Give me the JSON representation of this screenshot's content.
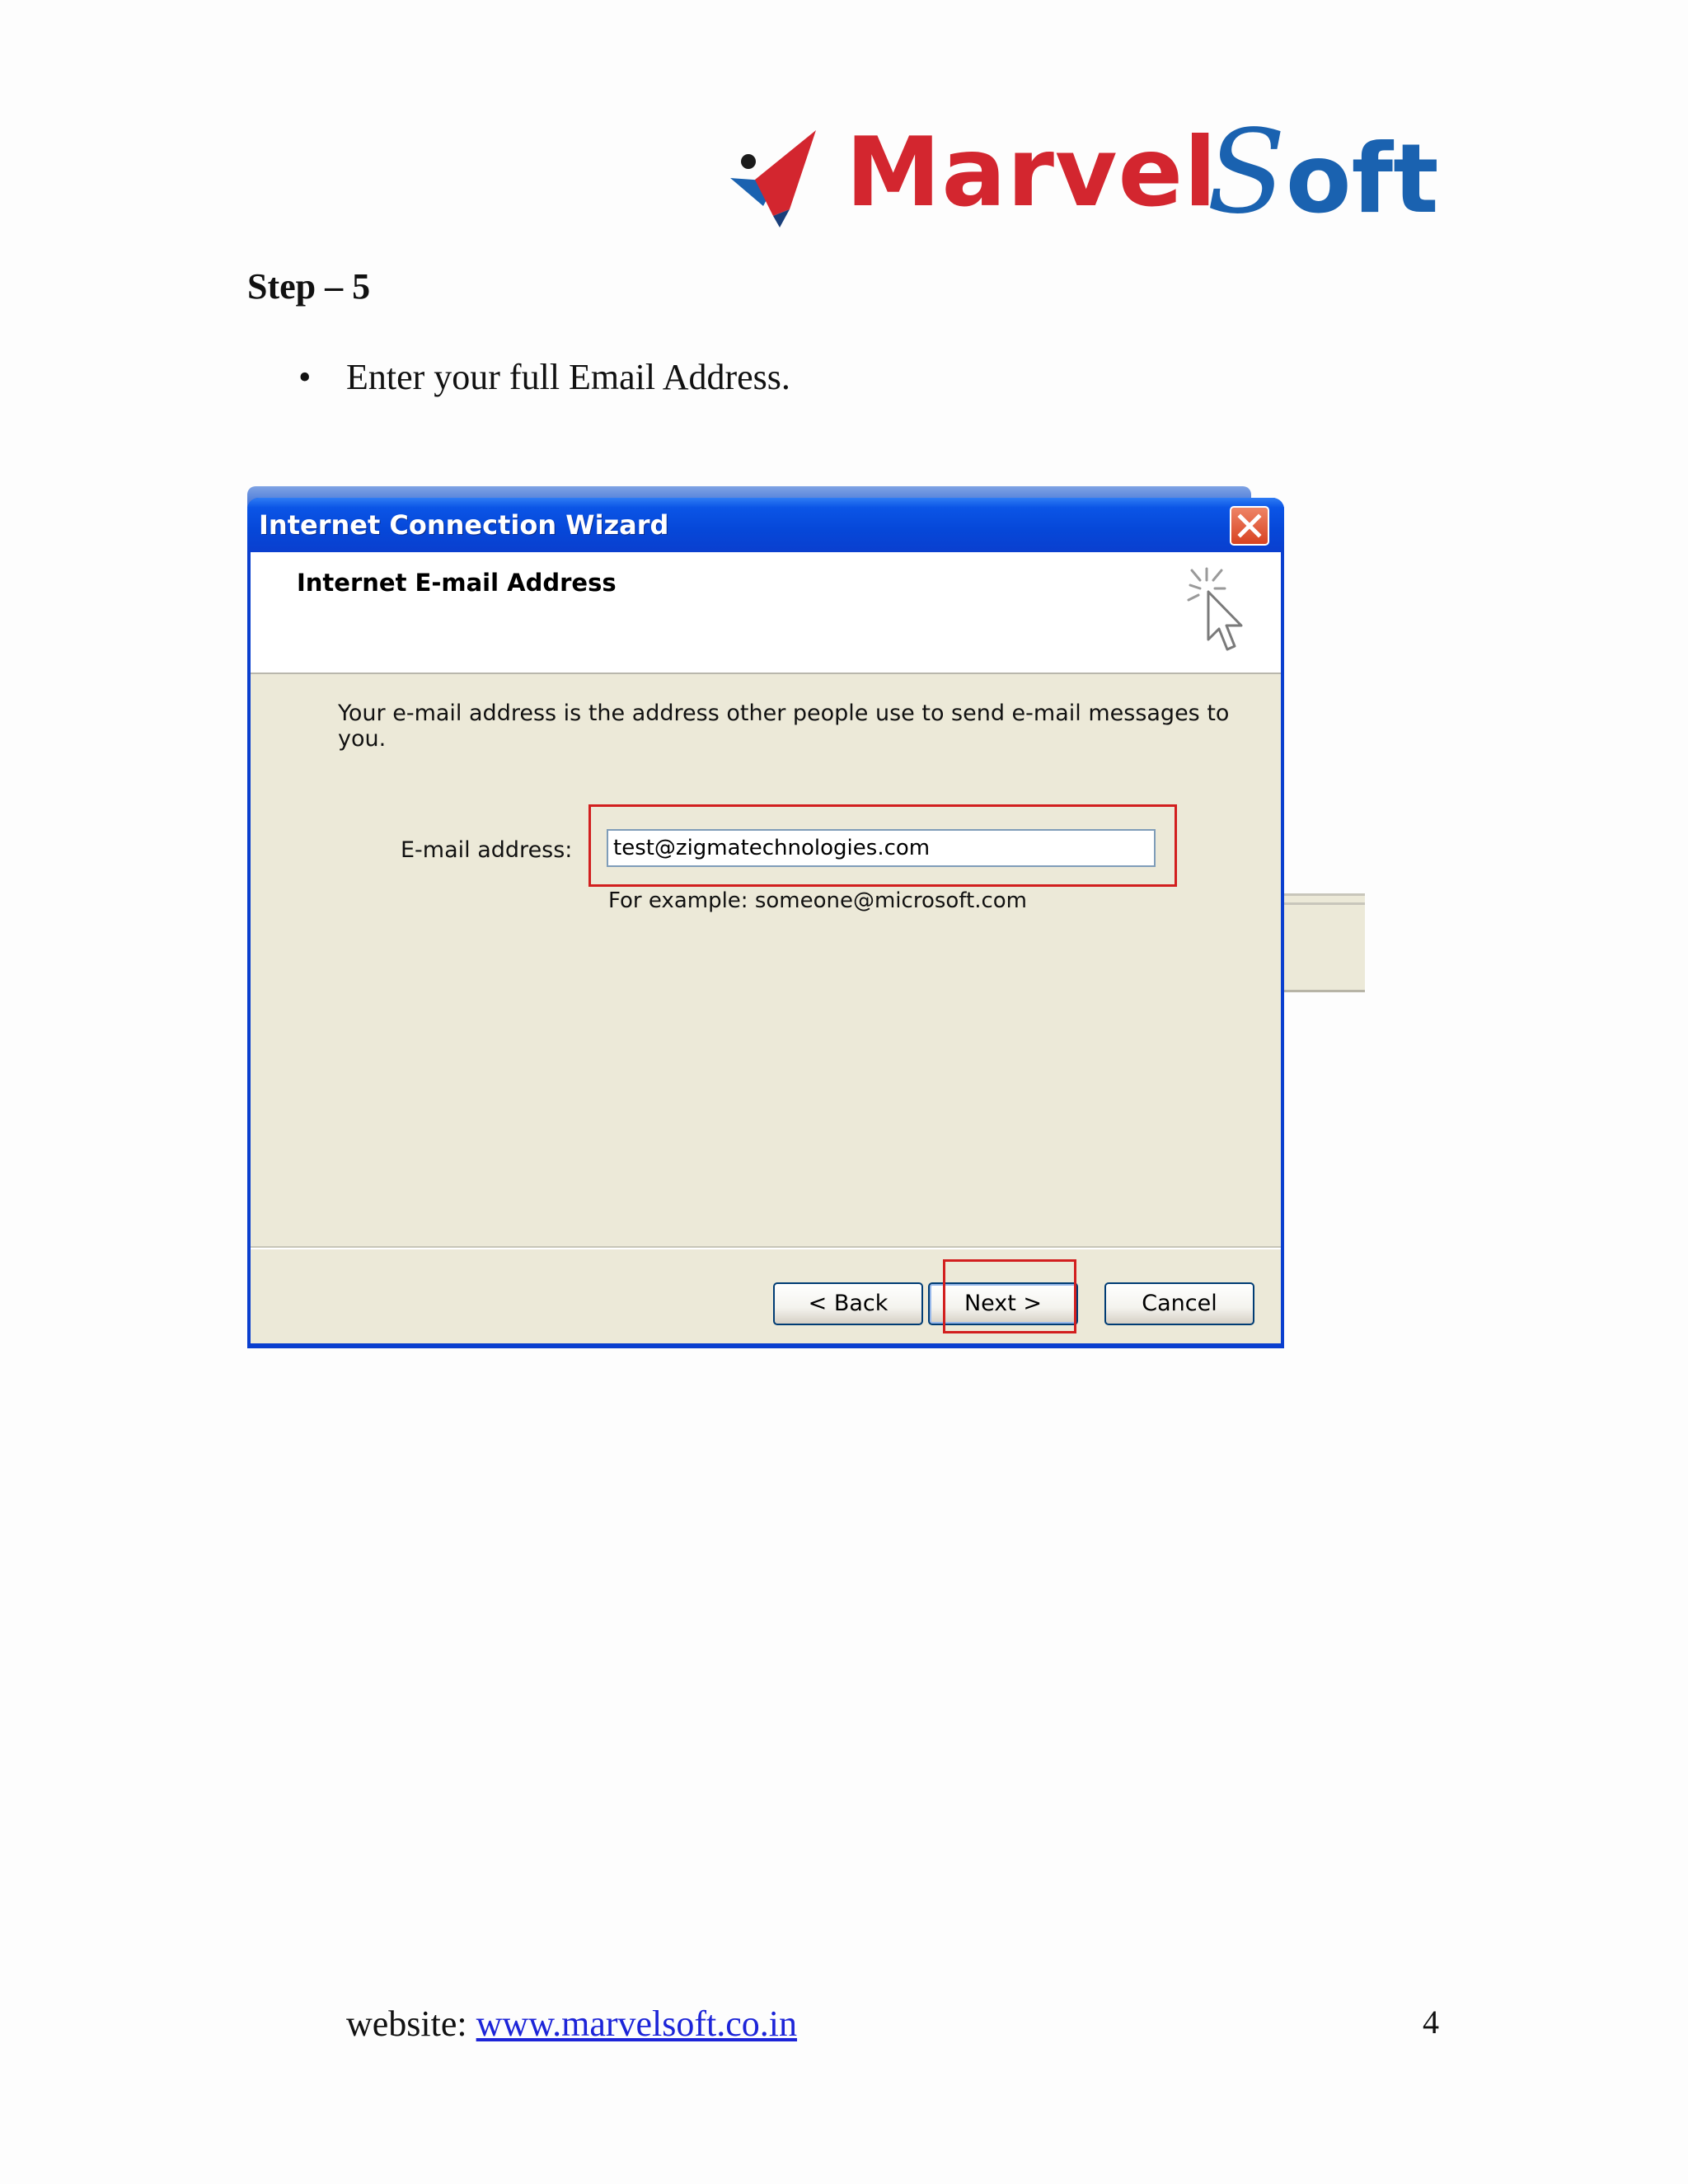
{
  "logo": {
    "part1": "Marvel",
    "part2_initial": "S",
    "part2_rest": "oft"
  },
  "step": {
    "title": "Step – 5"
  },
  "bullet": {
    "marker": "•",
    "text": "Enter your full Email Address."
  },
  "dialog": {
    "title": "Internet Connection Wizard",
    "header": "Internet E-mail Address",
    "description": "Your e-mail address is the address other people use to send e-mail messages to you.",
    "email_label": "E-mail address:",
    "email_value": "test@zigmatechnologies.com",
    "example": "For example: someone@microsoft.com",
    "buttons": {
      "back": "< Back",
      "next": "Next >",
      "cancel": "Cancel"
    }
  },
  "footer": {
    "website_label": "website: ",
    "website_url": "www.marvelsoft.co.in",
    "page_number": "4"
  },
  "colors": {
    "logo_red": "#d3262f",
    "logo_blue": "#1a62b0",
    "highlight_red": "#d21f1f",
    "xp_title_blue": "#0647d8",
    "dialog_body": "#ece9d8",
    "link_blue": "#1c24d8"
  }
}
